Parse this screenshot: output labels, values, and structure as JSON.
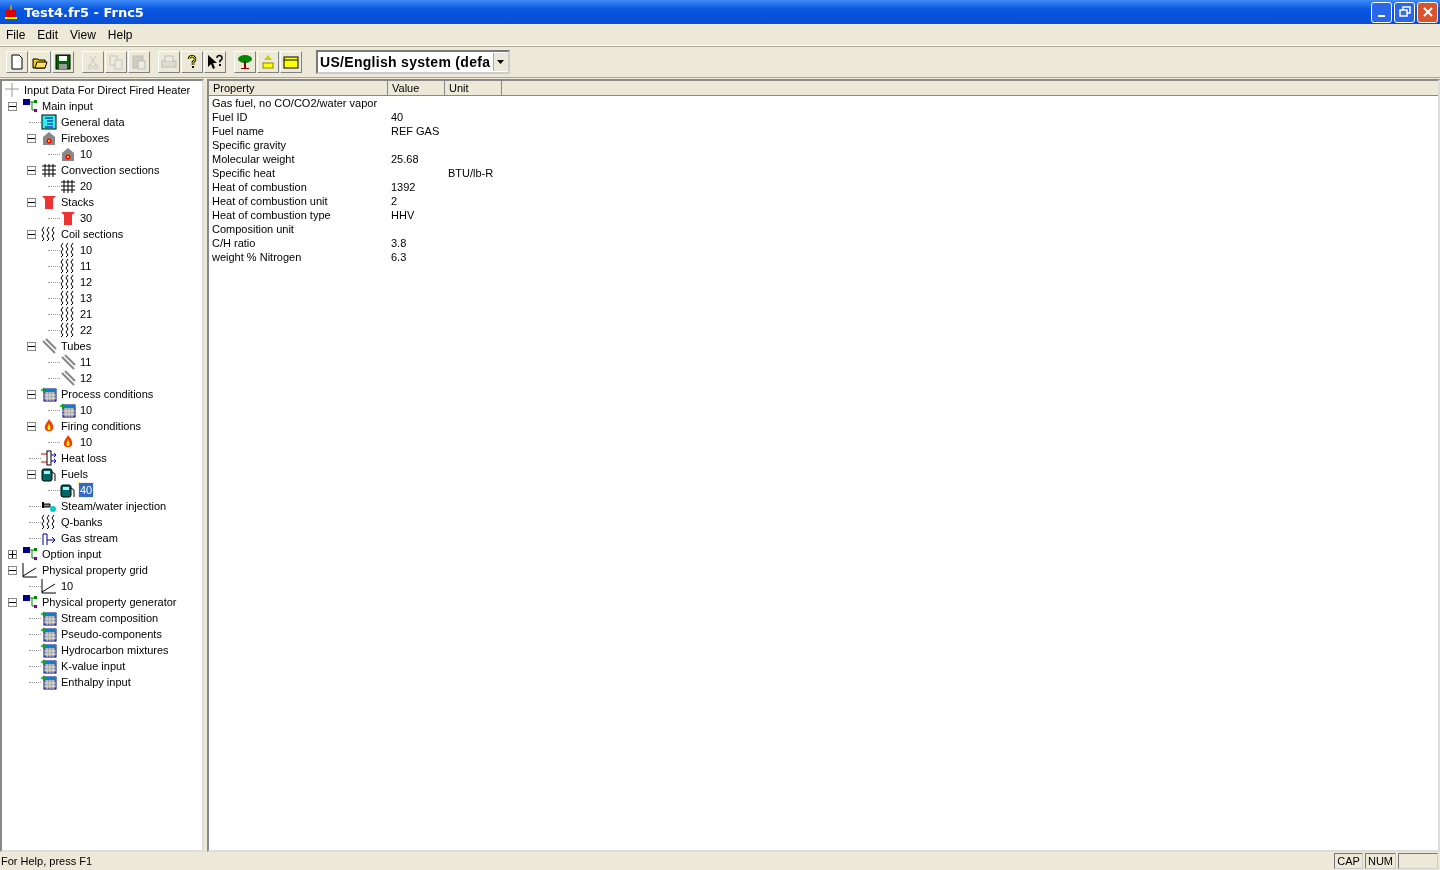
{
  "window": {
    "title": "Test4.fr5 - Frnc5"
  },
  "menu": [
    "File",
    "Edit",
    "View",
    "Help"
  ],
  "toolbar": {
    "groups": [
      [
        {
          "kind": "new",
          "disabled": false
        },
        {
          "kind": "open",
          "disabled": false
        },
        {
          "kind": "save",
          "disabled": false
        }
      ],
      [
        {
          "kind": "cut",
          "disabled": true
        },
        {
          "kind": "copy",
          "disabled": true
        },
        {
          "kind": "paste",
          "disabled": true
        }
      ],
      [
        {
          "kind": "print",
          "disabled": true
        },
        {
          "kind": "help",
          "disabled": false
        },
        {
          "kind": "context-help",
          "disabled": false
        }
      ],
      [
        {
          "kind": "tree",
          "disabled": false
        },
        {
          "kind": "import",
          "disabled": false
        },
        {
          "kind": "folder",
          "disabled": false
        }
      ]
    ],
    "unit_system": "US/English system (defa"
  },
  "tree": {
    "root": "Input Data For Direct Fired Heater",
    "items": [
      {
        "label": "Main input",
        "kind": "branch",
        "expanded": true,
        "selected": false,
        "children": [
          {
            "label": "General data",
            "kind": "data",
            "selected": false
          },
          {
            "label": "Fireboxes",
            "kind": "firebox",
            "expanded": true,
            "selected": false,
            "children": [
              {
                "label": "10",
                "kind": "firebox",
                "selected": false
              }
            ]
          },
          {
            "label": "Convection sections",
            "kind": "convection",
            "expanded": true,
            "selected": false,
            "children": [
              {
                "label": "20",
                "kind": "convection",
                "selected": false
              }
            ]
          },
          {
            "label": "Stacks",
            "kind": "stack",
            "expanded": true,
            "selected": false,
            "children": [
              {
                "label": "30",
                "kind": "stack",
                "selected": false
              }
            ]
          },
          {
            "label": "Coil sections",
            "kind": "coil",
            "expanded": true,
            "selected": false,
            "children": [
              {
                "label": "10",
                "kind": "coil",
                "selected": false
              },
              {
                "label": "11",
                "kind": "coil",
                "selected": false
              },
              {
                "label": "12",
                "kind": "coil",
                "selected": false
              },
              {
                "label": "13",
                "kind": "coil",
                "selected": false
              },
              {
                "label": "21",
                "kind": "coil",
                "selected": false
              },
              {
                "label": "22",
                "kind": "coil",
                "selected": false
              }
            ]
          },
          {
            "label": "Tubes",
            "kind": "tube",
            "expanded": true,
            "selected": false,
            "children": [
              {
                "label": "11",
                "kind": "tube",
                "selected": false
              },
              {
                "label": "12",
                "kind": "tube",
                "selected": false
              }
            ]
          },
          {
            "label": "Process conditions",
            "kind": "table",
            "expanded": true,
            "selected": false,
            "children": [
              {
                "label": "10",
                "kind": "table",
                "selected": false
              }
            ]
          },
          {
            "label": "Firing conditions",
            "kind": "flame",
            "expanded": true,
            "selected": false,
            "children": [
              {
                "label": "10",
                "kind": "flame",
                "selected": false
              }
            ]
          },
          {
            "label": "Heat loss",
            "kind": "heatloss",
            "selected": false
          },
          {
            "label": "Fuels",
            "kind": "fuel",
            "expanded": true,
            "selected": false,
            "children": [
              {
                "label": "40",
                "kind": "fuel",
                "selected": true
              }
            ]
          },
          {
            "label": "Steam/water injection",
            "kind": "steam",
            "selected": false
          },
          {
            "label": "Q-banks",
            "kind": "coil",
            "selected": false
          },
          {
            "label": "Gas stream",
            "kind": "stream",
            "selected": false
          }
        ]
      },
      {
        "label": "Option input",
        "kind": "branch",
        "expanded": false,
        "selected": false
      },
      {
        "label": "Physical property grid",
        "kind": "curve",
        "expanded": true,
        "selected": false,
        "children": [
          {
            "label": "10",
            "kind": "curve",
            "selected": false
          }
        ]
      },
      {
        "label": "Physical property generator",
        "kind": "branch",
        "expanded": true,
        "selected": false,
        "children": [
          {
            "label": "Stream composition",
            "kind": "table",
            "selected": false
          },
          {
            "label": "Pseudo-components",
            "kind": "table",
            "selected": false
          },
          {
            "label": "Hydrocarbon mixtures",
            "kind": "table",
            "selected": false
          },
          {
            "label": "K-value input",
            "kind": "table",
            "selected": false
          },
          {
            "label": "Enthalpy input",
            "kind": "table",
            "selected": false
          }
        ]
      }
    ]
  },
  "table": {
    "columns": [
      "Property",
      "Value",
      "Unit"
    ],
    "rows": [
      {
        "property": "Gas fuel, no CO/CO2/water vapor"
      },
      {
        "property": "Fuel ID",
        "value": "40"
      },
      {
        "property": "Fuel name",
        "value": "REF GAS"
      },
      {
        "property": "Specific gravity"
      },
      {
        "property": "Molecular weight",
        "value": "25.68"
      },
      {
        "property": "Specific heat",
        "unit": "BTU/lb-R"
      },
      {
        "property": "Heat of combustion",
        "value": "1392"
      },
      {
        "property": "Heat of combustion unit",
        "value": "2"
      },
      {
        "property": "Heat of combustion type",
        "value": "HHV"
      },
      {
        "property": "Composition unit"
      },
      {
        "property": "C/H ratio",
        "value": "3.8"
      },
      {
        "property": "weight % Nitrogen",
        "value": "6.3"
      }
    ]
  },
  "status_bar": {
    "message": "For Help, press F1",
    "indicators": [
      "CAP",
      "NUM"
    ]
  }
}
